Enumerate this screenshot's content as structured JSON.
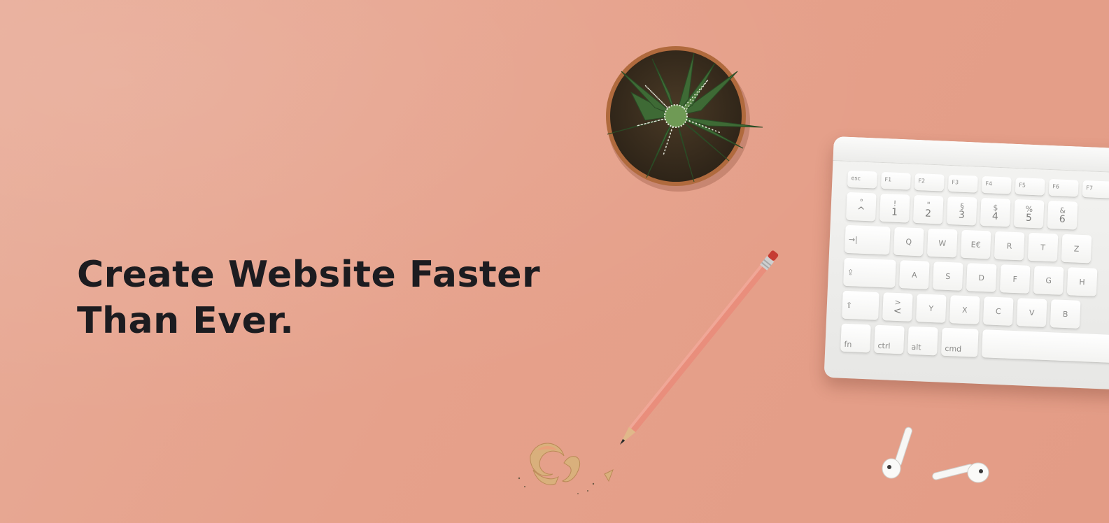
{
  "hero": {
    "headline_line1": "Create Website Faster",
    "headline_line2": "Than Ever.",
    "background_color": "#e6a18b",
    "text_color": "#1c1c20"
  },
  "keyboard": {
    "fn_row": [
      "esc",
      "F1",
      "F2",
      "F3",
      "F4",
      "F5",
      "F6",
      "F7"
    ],
    "number_row": [
      {
        "top": "°",
        "bottom": "^"
      },
      {
        "top": "!",
        "bottom": "1"
      },
      {
        "top": "\"",
        "bottom": "2"
      },
      {
        "top": "§",
        "bottom": "3"
      },
      {
        "top": "$",
        "bottom": "4"
      },
      {
        "top": "%",
        "bottom": "5"
      },
      {
        "top": "&",
        "bottom": "6"
      }
    ],
    "tab_label": "→|",
    "qwerty_row": [
      "Q",
      "W",
      "E€",
      "R",
      "T",
      "Z"
    ],
    "caps_label": "⇪",
    "home_row": [
      "A",
      "S",
      "D",
      "F",
      "G",
      "H"
    ],
    "shift_label": "⇧",
    "bottom_left_row": [
      {
        "top": ">",
        "bottom": "<"
      },
      {
        "top": "",
        "bottom": "Y"
      },
      {
        "top": "",
        "bottom": "X"
      },
      {
        "top": "",
        "bottom": "C"
      },
      {
        "top": "",
        "bottom": "V"
      },
      {
        "top": "",
        "bottom": "B"
      }
    ],
    "modifier_row": [
      "fn",
      "ctrl",
      "alt",
      "cmd"
    ]
  },
  "icons": {
    "plant": "succulent-plant-icon",
    "pencil": "pencil-icon",
    "shavings": "pencil-shavings-icon",
    "earbuds": "earbuds-icon",
    "keyboard": "keyboard-icon"
  }
}
